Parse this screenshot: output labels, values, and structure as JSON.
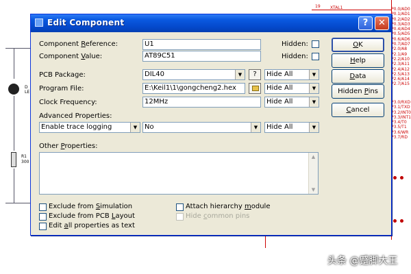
{
  "background": {
    "xtal_pin_number": "19",
    "xtal_pin_label": "XTAL1",
    "port_pins_top": [
      "P0.0/AD0",
      "P0.1/AD1",
      "P0.2/AD2",
      "P0.3/AD3",
      "P0.4/AD4",
      "P0.5/AD5",
      "P0.6/AD6",
      "P0.7/AD7",
      "P2.0/A8",
      "P2.1/A9",
      "P2.2/A10",
      "P2.3/A11",
      "P2.4/A12",
      "P2.5/A13",
      "P2.6/A14",
      "P2.7/A15"
    ],
    "port_pins_bottom": [
      "P3.0/RXD",
      "P3.1/TXD",
      "P3.2/INT0",
      "P3.3/INT1",
      "P3.4/T0",
      "P3.5/T1",
      "P3.6/WR",
      "P3.7/RD"
    ],
    "left_labels": [
      "D",
      "LE",
      "R1",
      "300"
    ],
    "watermark": "头条 @蹙脚大王"
  },
  "window": {
    "title": "Edit Component",
    "help_button_glyph": "?",
    "close_button_glyph": "✕"
  },
  "form": {
    "component_reference": {
      "label_pre": "Component ",
      "label_u": "R",
      "label_post": "eference:",
      "value": "U1"
    },
    "component_value": {
      "label_pre": "Component ",
      "label_u": "V",
      "label_post": "alue:",
      "value": "AT89C51"
    },
    "hidden_label": "Hidden:",
    "pcb_package": {
      "label": "PCB Package:",
      "value": "DIL40",
      "help_glyph": "?",
      "visibility": "Hide All"
    },
    "program_file": {
      "label": "Program File:",
      "value": "E:\\Keil1\\1\\gongcheng2.hex",
      "visibility": "Hide All"
    },
    "clock_frequency": {
      "label": "Clock Frequency:",
      "value": "12MHz",
      "visibility": "Hide All"
    },
    "advanced_properties": {
      "label": "Advanced Properties:",
      "property": "Enable trace logging",
      "value": "No",
      "visibility": "Hide All"
    },
    "other_properties": {
      "label_pre": "Other ",
      "label_u": "P",
      "label_post": "roperties:",
      "value": ""
    }
  },
  "options": {
    "exclude_simulation": {
      "pre": "Exclude from ",
      "u": "S",
      "post": "imulation"
    },
    "exclude_pcb": {
      "pre": "Exclude from PCB ",
      "u": "L",
      "post": "ayout"
    },
    "edit_all": {
      "pre": "Edit ",
      "u": "a",
      "post": "ll properties as text"
    },
    "attach_hierarchy": {
      "pre": "Attach hierarchy ",
      "u": "m",
      "post": "odule"
    },
    "hide_common_pins": {
      "pre": "Hide ",
      "u": "c",
      "post": "ommon pins"
    }
  },
  "buttons": {
    "ok": {
      "u": "O",
      "post": "K"
    },
    "help": {
      "u": "H",
      "post": "elp"
    },
    "data": {
      "u": "D",
      "post": "ata"
    },
    "hidden_pins": {
      "pre": "Hidden ",
      "u": "P",
      "post": "ins"
    },
    "cancel": {
      "u": "C",
      "post": "ancel"
    }
  },
  "colors": {
    "titlebar": "#0a59e0",
    "dialog_bg": "#ece9d8",
    "schematic_red": "#cc0000"
  }
}
